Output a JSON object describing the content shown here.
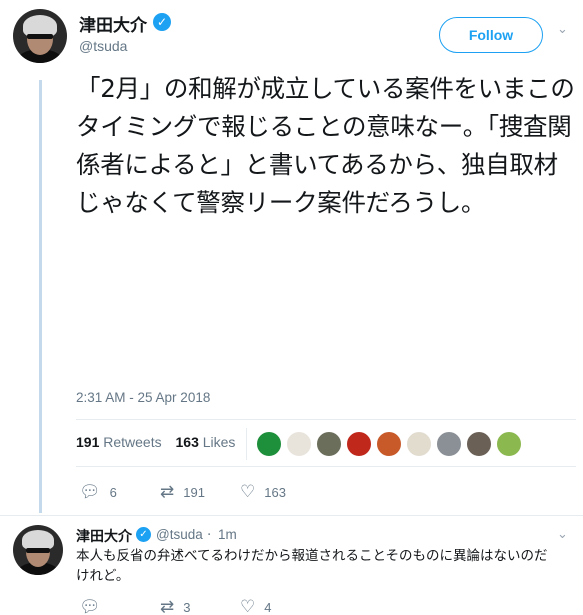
{
  "tweet": {
    "author_name": "津田大介",
    "author_handle": "@tsuda",
    "follow_label": "Follow",
    "text": "「2月」の和解が成立している案件をいまこのタイミングで報じることの意味なー。「捜査関係者によると」と書いてあるから、独自取材じゃなくて警察リーク案件だろうし。",
    "timestamp": "2:31 AM - 25 Apr 2018",
    "retweets_count": "191",
    "retweets_label": "Retweets",
    "likes_count": "163",
    "likes_label": "Likes",
    "actions": {
      "replies": "6",
      "retweets": "191",
      "likes": "163"
    },
    "likers": [
      {
        "icon": "liker-avatar-1",
        "color": "#1e8f3a"
      },
      {
        "icon": "liker-avatar-2",
        "color": "#e8e4dc"
      },
      {
        "icon": "liker-avatar-3",
        "color": "#6b6e5a"
      },
      {
        "icon": "liker-avatar-4",
        "color": "#c0281c"
      },
      {
        "icon": "liker-avatar-5",
        "color": "#c85a2a"
      },
      {
        "icon": "liker-avatar-6",
        "color": "#e2dccf"
      },
      {
        "icon": "liker-avatar-7",
        "color": "#8a9096"
      },
      {
        "icon": "liker-avatar-8",
        "color": "#6a6055"
      },
      {
        "icon": "liker-avatar-9",
        "color": "#8cb850"
      }
    ]
  },
  "reply": {
    "author_name": "津田大介",
    "author_handle": "@tsuda",
    "separator": "·",
    "time": "1m",
    "text": "本人も反省の弁述べてるわけだから報道されることそのものに異論はないのだけれど。",
    "actions": {
      "replies": "",
      "retweets": "3",
      "likes": "4"
    }
  },
  "colors": {
    "accent": "#1da1f2",
    "muted": "#657786",
    "thread": "#c4d9ec"
  }
}
